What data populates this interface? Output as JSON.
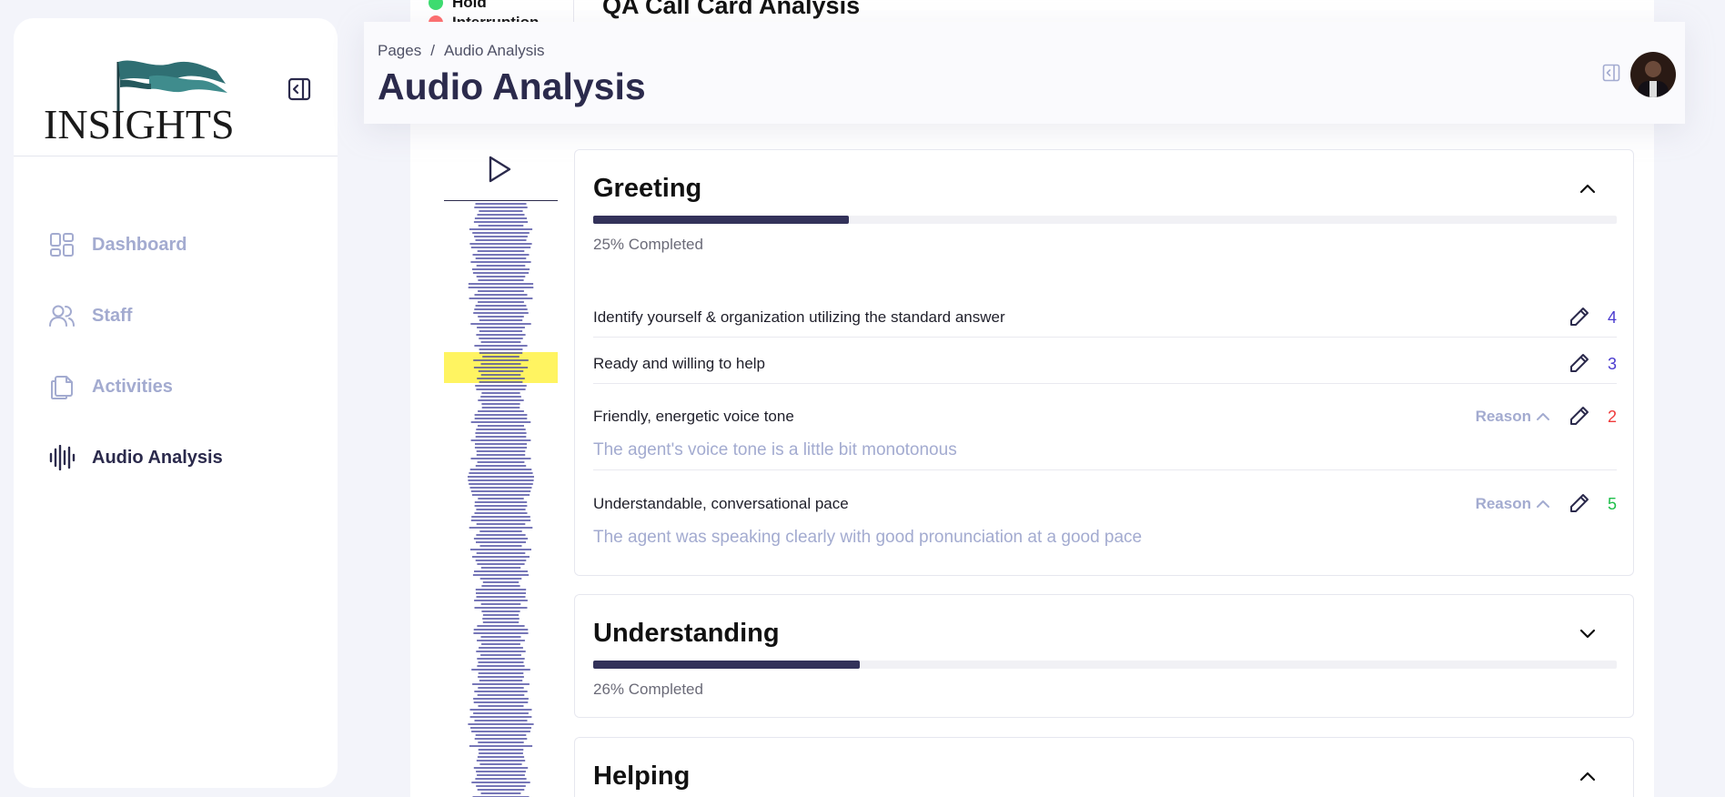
{
  "sidebar": {
    "logo_text": "INSIGHTS",
    "items": [
      {
        "label": "Dashboard",
        "icon": "dashboard-icon"
      },
      {
        "label": "Staff",
        "icon": "users-icon"
      },
      {
        "label": "Activities",
        "icon": "documents-icon"
      },
      {
        "label": "Audio Analysis",
        "icon": "audio-wave-icon"
      }
    ]
  },
  "background": {
    "legend": [
      {
        "label": "Hold",
        "color": "#3ddc6f"
      },
      {
        "label": "Interruption",
        "color": "#ff6b6b"
      }
    ],
    "title": "QA Call Card Analysis"
  },
  "header": {
    "breadcrumb": {
      "root": "Pages",
      "separator": "/",
      "current": "Audio Analysis"
    },
    "title": "Audio Analysis"
  },
  "player": {
    "play_icon": "play-icon",
    "highlight_color": "#fff350"
  },
  "sections": [
    {
      "title": "Greeting",
      "expanded": true,
      "progress": 25,
      "progress_label": "25% Completed",
      "items": [
        {
          "text": "Identify yourself & organization utilizing the standard answer",
          "score": "4",
          "score_color": "#4b3ccf"
        },
        {
          "text": "Ready and willing to help",
          "score": "3",
          "score_color": "#4b3ccf"
        },
        {
          "text": "Friendly, energetic voice tone",
          "reason_label": "Reason",
          "reason": "The agent's voice tone is a little bit monotonous",
          "score": "2",
          "score_color": "#ef3b3b"
        },
        {
          "text": "Understandable, conversational pace",
          "reason_label": "Reason",
          "reason": "The agent was speaking clearly with good pronunciation at a good pace",
          "score": "5",
          "score_color": "#1fbf4a"
        }
      ]
    },
    {
      "title": "Understanding",
      "expanded": false,
      "progress": 26,
      "progress_label": "26% Completed"
    },
    {
      "title": "Helping",
      "expanded": true
    }
  ],
  "colors": {
    "primary": "#2b2a4c",
    "muted": "#a3abd0",
    "background": "#f3f4fa"
  }
}
